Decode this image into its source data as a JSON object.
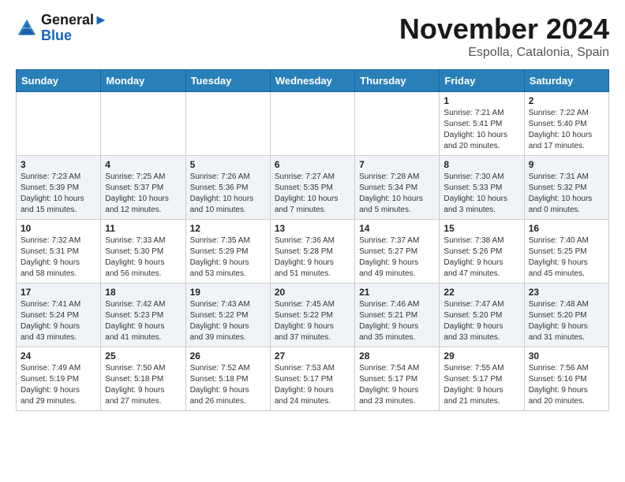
{
  "header": {
    "logo_line1": "General",
    "logo_line2": "Blue",
    "month": "November 2024",
    "location": "Espolla, Catalonia, Spain"
  },
  "weekdays": [
    "Sunday",
    "Monday",
    "Tuesday",
    "Wednesday",
    "Thursday",
    "Friday",
    "Saturday"
  ],
  "weeks": [
    [
      {
        "day": "",
        "info": ""
      },
      {
        "day": "",
        "info": ""
      },
      {
        "day": "",
        "info": ""
      },
      {
        "day": "",
        "info": ""
      },
      {
        "day": "",
        "info": ""
      },
      {
        "day": "1",
        "info": "Sunrise: 7:21 AM\nSunset: 5:41 PM\nDaylight: 10 hours\nand 20 minutes."
      },
      {
        "day": "2",
        "info": "Sunrise: 7:22 AM\nSunset: 5:40 PM\nDaylight: 10 hours\nand 17 minutes."
      }
    ],
    [
      {
        "day": "3",
        "info": "Sunrise: 7:23 AM\nSunset: 5:39 PM\nDaylight: 10 hours\nand 15 minutes."
      },
      {
        "day": "4",
        "info": "Sunrise: 7:25 AM\nSunset: 5:37 PM\nDaylight: 10 hours\nand 12 minutes."
      },
      {
        "day": "5",
        "info": "Sunrise: 7:26 AM\nSunset: 5:36 PM\nDaylight: 10 hours\nand 10 minutes."
      },
      {
        "day": "6",
        "info": "Sunrise: 7:27 AM\nSunset: 5:35 PM\nDaylight: 10 hours\nand 7 minutes."
      },
      {
        "day": "7",
        "info": "Sunrise: 7:28 AM\nSunset: 5:34 PM\nDaylight: 10 hours\nand 5 minutes."
      },
      {
        "day": "8",
        "info": "Sunrise: 7:30 AM\nSunset: 5:33 PM\nDaylight: 10 hours\nand 3 minutes."
      },
      {
        "day": "9",
        "info": "Sunrise: 7:31 AM\nSunset: 5:32 PM\nDaylight: 10 hours\nand 0 minutes."
      }
    ],
    [
      {
        "day": "10",
        "info": "Sunrise: 7:32 AM\nSunset: 5:31 PM\nDaylight: 9 hours\nand 58 minutes."
      },
      {
        "day": "11",
        "info": "Sunrise: 7:33 AM\nSunset: 5:30 PM\nDaylight: 9 hours\nand 56 minutes."
      },
      {
        "day": "12",
        "info": "Sunrise: 7:35 AM\nSunset: 5:29 PM\nDaylight: 9 hours\nand 53 minutes."
      },
      {
        "day": "13",
        "info": "Sunrise: 7:36 AM\nSunset: 5:28 PM\nDaylight: 9 hours\nand 51 minutes."
      },
      {
        "day": "14",
        "info": "Sunrise: 7:37 AM\nSunset: 5:27 PM\nDaylight: 9 hours\nand 49 minutes."
      },
      {
        "day": "15",
        "info": "Sunrise: 7:38 AM\nSunset: 5:26 PM\nDaylight: 9 hours\nand 47 minutes."
      },
      {
        "day": "16",
        "info": "Sunrise: 7:40 AM\nSunset: 5:25 PM\nDaylight: 9 hours\nand 45 minutes."
      }
    ],
    [
      {
        "day": "17",
        "info": "Sunrise: 7:41 AM\nSunset: 5:24 PM\nDaylight: 9 hours\nand 43 minutes."
      },
      {
        "day": "18",
        "info": "Sunrise: 7:42 AM\nSunset: 5:23 PM\nDaylight: 9 hours\nand 41 minutes."
      },
      {
        "day": "19",
        "info": "Sunrise: 7:43 AM\nSunset: 5:22 PM\nDaylight: 9 hours\nand 39 minutes."
      },
      {
        "day": "20",
        "info": "Sunrise: 7:45 AM\nSunset: 5:22 PM\nDaylight: 9 hours\nand 37 minutes."
      },
      {
        "day": "21",
        "info": "Sunrise: 7:46 AM\nSunset: 5:21 PM\nDaylight: 9 hours\nand 35 minutes."
      },
      {
        "day": "22",
        "info": "Sunrise: 7:47 AM\nSunset: 5:20 PM\nDaylight: 9 hours\nand 33 minutes."
      },
      {
        "day": "23",
        "info": "Sunrise: 7:48 AM\nSunset: 5:20 PM\nDaylight: 9 hours\nand 31 minutes."
      }
    ],
    [
      {
        "day": "24",
        "info": "Sunrise: 7:49 AM\nSunset: 5:19 PM\nDaylight: 9 hours\nand 29 minutes."
      },
      {
        "day": "25",
        "info": "Sunrise: 7:50 AM\nSunset: 5:18 PM\nDaylight: 9 hours\nand 27 minutes."
      },
      {
        "day": "26",
        "info": "Sunrise: 7:52 AM\nSunset: 5:18 PM\nDaylight: 9 hours\nand 26 minutes."
      },
      {
        "day": "27",
        "info": "Sunrise: 7:53 AM\nSunset: 5:17 PM\nDaylight: 9 hours\nand 24 minutes."
      },
      {
        "day": "28",
        "info": "Sunrise: 7:54 AM\nSunset: 5:17 PM\nDaylight: 9 hours\nand 23 minutes."
      },
      {
        "day": "29",
        "info": "Sunrise: 7:55 AM\nSunset: 5:17 PM\nDaylight: 9 hours\nand 21 minutes."
      },
      {
        "day": "30",
        "info": "Sunrise: 7:56 AM\nSunset: 5:16 PM\nDaylight: 9 hours\nand 20 minutes."
      }
    ]
  ]
}
